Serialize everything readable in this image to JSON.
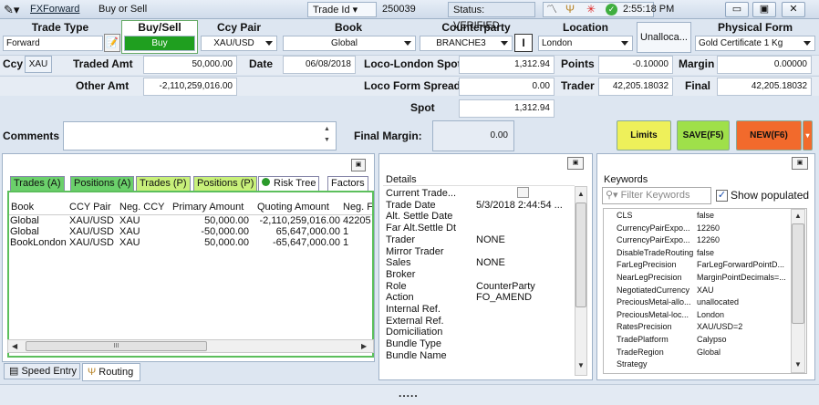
{
  "title": {
    "app_link": "FXForward",
    "subtitle": "Buy or Sell",
    "trade_id_label": "Trade Id",
    "trade_id": "250039",
    "status": "Status: VERIFIED",
    "time": "2:55:18 PM"
  },
  "headers": {
    "trade_type": "Trade Type",
    "buy_sell": "Buy/Sell",
    "ccy_pair": "Ccy Pair",
    "book": "Book",
    "counterparty": "Counterparty",
    "location": "Location",
    "unallocated": "Unalloca...",
    "physical_form": "Physical Form"
  },
  "values": {
    "trade_type": "Forward",
    "buy_sell": "Buy",
    "ccy_pair": "XAU/USD",
    "book": "Global",
    "counterparty": "BRANCHE3",
    "location": "London",
    "physical_form": "Gold Certificate 1 Kg"
  },
  "row2": {
    "ccy_label": "Ccy",
    "ccy": "XAU",
    "traded_amt_label": "Traded Amt",
    "traded_amt": "50,000.00",
    "date_label": "Date",
    "date": "06/08/2018",
    "lls_label": "Loco-London Spot",
    "lls": "1,312.94",
    "points_label": "Points",
    "points": "-0.10000",
    "margin_label": "Margin",
    "margin": "0.00000"
  },
  "row3": {
    "other_amt_label": "Other Amt",
    "other_amt": "-2,110,259,016.00",
    "lfs_label": "Loco Form Spread",
    "lfs": "0.00",
    "trader_label": "Trader",
    "trader": "42,205.18032",
    "final_label": "Final",
    "final": "42,205.18032"
  },
  "row4": {
    "spot_label": "Spot",
    "spot": "1,312.94"
  },
  "comments": {
    "label": "Comments",
    "final_margin_label": "Final Margin:",
    "final_margin": "0.00"
  },
  "buttons": {
    "limits": "Limits",
    "save": "SAVE(F5)",
    "new": "NEW(F6)"
  },
  "tabs": [
    "Trades (A)",
    "Positions (A)",
    "Trades (P)",
    "Positions (P)",
    "Risk Tree",
    "Factors"
  ],
  "grid": {
    "columns": [
      "Book",
      "CCY Pair",
      "Neg. CCY",
      "Primary Amount",
      "Quoting Amount",
      "Neg. F"
    ],
    "rows": [
      [
        "Global",
        "XAU/USD",
        "XAU",
        "50,000.00",
        "-2,110,259,016.00",
        "42205"
      ],
      [
        "Global",
        "XAU/USD",
        "XAU",
        "-50,000.00",
        "65,647,000.00",
        "1"
      ],
      [
        "BookLondon",
        "XAU/USD",
        "XAU",
        "50,000.00",
        "-65,647,000.00",
        "1"
      ]
    ]
  },
  "scroll_mid": "III",
  "bottom_tabs": [
    "Speed Entry",
    "Routing"
  ],
  "details": {
    "title": "Details",
    "rows": [
      [
        "Current Trade...",
        ""
      ],
      [
        "Trade Date",
        "5/3/2018 2:44:54 ..."
      ],
      [
        "Alt. Settle Date",
        ""
      ],
      [
        "Far Alt.Settle Dt",
        ""
      ],
      [
        "Trader",
        "NONE"
      ],
      [
        "Mirror Trader",
        ""
      ],
      [
        "Sales",
        "NONE"
      ],
      [
        "Broker",
        ""
      ],
      [
        "Role",
        "CounterParty"
      ],
      [
        "Action",
        "FO_AMEND"
      ],
      [
        "Internal Ref.",
        ""
      ],
      [
        "External Ref.",
        ""
      ],
      [
        "Domiciliation",
        ""
      ],
      [
        "Bundle Type",
        ""
      ],
      [
        "Bundle Name",
        ""
      ]
    ]
  },
  "keywords": {
    "title": "Keywords",
    "filter_placeholder": "Filter Keywords",
    "show_populated": "Show populated",
    "rows": [
      [
        "CLS",
        "false"
      ],
      [
        "CurrencyPairExpo...",
        "12260"
      ],
      [
        "CurrencyPairExpo...",
        "12260"
      ],
      [
        "DisableTradeRouting",
        "false"
      ],
      [
        "FarLegPrecision",
        "FarLegForwardPointD..."
      ],
      [
        "NearLegPrecision",
        "MarginPointDecimals=..."
      ],
      [
        "NegotiatedCurrency",
        "XAU"
      ],
      [
        "PreciousMetal-allo...",
        "unallocated"
      ],
      [
        "PreciousMetal-loc...",
        "London"
      ],
      [
        "RatesPrecision",
        "XAU/USD=2"
      ],
      [
        "TradePlatform",
        "Calypso"
      ],
      [
        "TradeRegion",
        "Global"
      ],
      [
        "Strategy",
        ""
      ]
    ]
  },
  "splitter": "....."
}
